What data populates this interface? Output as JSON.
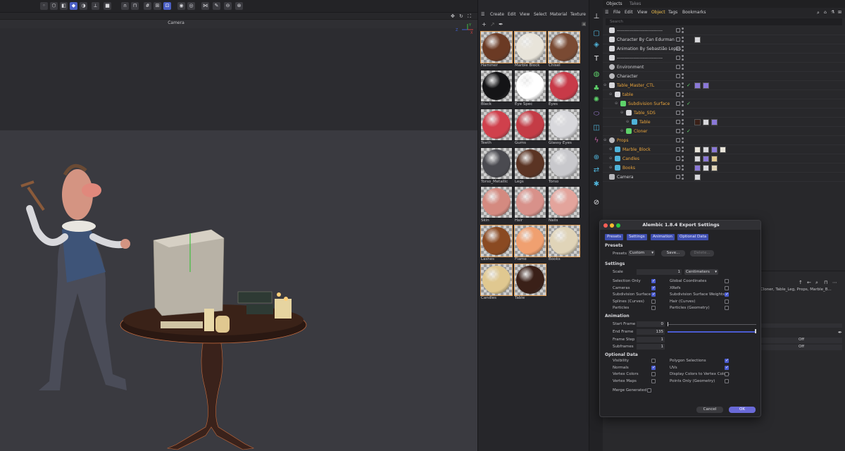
{
  "viewport": {
    "camera_label": "Camera",
    "axis": {
      "z": "Z",
      "x": "X",
      "y": "Y"
    }
  },
  "material_manager": {
    "menu": [
      "Create",
      "Edit",
      "View",
      "Select",
      "Material",
      "Texture"
    ],
    "materials": [
      {
        "name": "Hammer",
        "color": "#6b3a24",
        "selected": true
      },
      {
        "name": "Marble Block",
        "color": "#e8e4da",
        "selected": true
      },
      {
        "name": "Chisel",
        "color": "#7a4a33",
        "selected": true
      },
      {
        "name": "Black",
        "color": "#141416",
        "selected": false
      },
      {
        "name": "Eye Spec",
        "color": "#ffffff",
        "selected": false
      },
      {
        "name": "Eyes",
        "color": "#c83a48",
        "selected": false
      },
      {
        "name": "Teeth",
        "color": "#d0404c",
        "selected": false
      },
      {
        "name": "Gums",
        "color": "#c43c46",
        "selected": false
      },
      {
        "name": "Glassy Eyes",
        "color": "#d8d8dc",
        "selected": false
      },
      {
        "name": "Torso_Metallic",
        "color": "#4a4a50",
        "selected": false
      },
      {
        "name": "Legs",
        "color": "#5b3424",
        "selected": false
      },
      {
        "name": "Torso",
        "color": "#c8c8cc",
        "selected": false
      },
      {
        "name": "Skin",
        "color": "#d48a80",
        "selected": false
      },
      {
        "name": "Hair",
        "color": "#d8918a",
        "selected": false
      },
      {
        "name": "Nails",
        "color": "#e3a49c",
        "selected": false
      },
      {
        "name": "Lashes",
        "color": "#8a4a22",
        "selected": true
      },
      {
        "name": "Flame",
        "color": "#f0a070",
        "selected": true
      },
      {
        "name": "Books",
        "color": "#e0d4b8",
        "selected": true
      },
      {
        "name": "Candles",
        "color": "#e0c890",
        "selected": true
      },
      {
        "name": "Table",
        "color": "#3a2018",
        "selected": true
      }
    ]
  },
  "object_manager": {
    "tabs": [
      "Objects",
      "Takes"
    ],
    "menu": [
      "File",
      "Edit",
      "View",
      "Object",
      "Tags",
      "Bookmarks"
    ],
    "active_menu": "Object",
    "search_placeholder": "Search",
    "rows": [
      {
        "name": "------------------------------",
        "indent": 0,
        "color": "#cfcfd3",
        "icon": "null-icon",
        "check": false
      },
      {
        "name": "Character By Can Edurman",
        "indent": 0,
        "color": "#cfcfd3",
        "icon": "null-icon",
        "check": false
      },
      {
        "name": "Animation By Sebastião Lopes",
        "indent": 0,
        "color": "#cfcfd3",
        "icon": "null-icon",
        "check": false
      },
      {
        "name": "------------------------------",
        "indent": 0,
        "color": "#cfcfd3",
        "icon": "null-icon",
        "check": false
      },
      {
        "name": "Environment",
        "indent": 0,
        "color": "#cfcfd3",
        "icon": "sphere-icon",
        "check": false
      },
      {
        "name": "Character",
        "indent": 0,
        "color": "#cfcfd3",
        "icon": "sphere-icon",
        "check": false
      },
      {
        "name": "Table_Master_CTL",
        "indent": 0,
        "color": "#e9a43c",
        "icon": "null-icon",
        "check": true
      },
      {
        "name": "table",
        "indent": 1,
        "color": "#e9a43c",
        "icon": "null-icon",
        "check": false
      },
      {
        "name": "Subdivision Surface",
        "indent": 2,
        "color": "#e9a43c",
        "icon": "subdivision-icon",
        "check": true
      },
      {
        "name": "Table_SDS",
        "indent": 3,
        "color": "#e9a43c",
        "icon": "null-icon",
        "check": false
      },
      {
        "name": "Table",
        "indent": 4,
        "color": "#e9a43c",
        "icon": "mesh-icon",
        "check": false
      },
      {
        "name": "Cloner",
        "indent": 3,
        "color": "#e9a43c",
        "icon": "cloner-icon",
        "check": true
      },
      {
        "name": "Props",
        "indent": 0,
        "color": "#e9a43c",
        "icon": "sphere-icon",
        "check": false
      },
      {
        "name": "Marble_Block",
        "indent": 1,
        "color": "#e9a43c",
        "icon": "mesh-icon",
        "check": false
      },
      {
        "name": "Candles",
        "indent": 1,
        "color": "#e9a43c",
        "icon": "mesh-icon",
        "check": false
      },
      {
        "name": "Books",
        "indent": 1,
        "color": "#e9a43c",
        "icon": "mesh-icon",
        "check": false
      },
      {
        "name": "Camera",
        "indent": 0,
        "color": "#cfcfd3",
        "icon": "camera-icon",
        "check": false
      }
    ],
    "attr_text": "Cloner, Table_Leg, Props, Marble_B...",
    "attr_off_1": "Off",
    "attr_off_2": "Off"
  },
  "dialog": {
    "title": "Alembic 1.8.4 Export Settings",
    "tabs": [
      "Presets",
      "Settings",
      "Animation",
      "Optional Data"
    ],
    "presets": {
      "section": "Presets",
      "label": "Presets",
      "value": "Custom",
      "save": "Save...",
      "delete": "Delete..."
    },
    "settings": {
      "section": "Settings",
      "scale_label": "Scale",
      "scale_value": "1",
      "scale_unit": "Centimeters",
      "left": [
        {
          "label": "Selection Only",
          "checked": true
        },
        {
          "label": "Cameras",
          "checked": true
        },
        {
          "label": "Subdivision Surface",
          "checked": true
        },
        {
          "label": "Splines (Curves)",
          "checked": false
        },
        {
          "label": "Particles",
          "checked": false
        }
      ],
      "right": [
        {
          "label": "Global Coordinates",
          "checked": false
        },
        {
          "label": "XRefs",
          "checked": false
        },
        {
          "label": "Subdivision Surface Weights",
          "checked": true
        },
        {
          "label": "Hair (Curves)",
          "checked": false
        },
        {
          "label": "Particles (Geometry)",
          "checked": false
        }
      ]
    },
    "animation": {
      "section": "Animation",
      "start_label": "Start Frame",
      "start_value": "0",
      "end_label": "End Frame",
      "end_value": "135",
      "step_label": "Frame Step",
      "step_value": "1",
      "sub_label": "Subframes",
      "sub_value": "1"
    },
    "optional": {
      "section": "Optional Data",
      "left": [
        {
          "label": "Visibility",
          "checked": false
        },
        {
          "label": "Normals",
          "checked": true
        },
        {
          "label": "Vertex Colors",
          "checked": false
        },
        {
          "label": "Vertex Maps",
          "checked": false
        }
      ],
      "right": [
        {
          "label": "Polygon Selections",
          "checked": true
        },
        {
          "label": "UVs",
          "checked": true
        },
        {
          "label": "Display Colors to Vertex Colors",
          "checked": false
        },
        {
          "label": "Points Only (Geometry)",
          "checked": false
        }
      ],
      "merge_label": "Merge Generated",
      "merge_checked": false
    },
    "cancel": "Cancel",
    "ok": "OK"
  }
}
